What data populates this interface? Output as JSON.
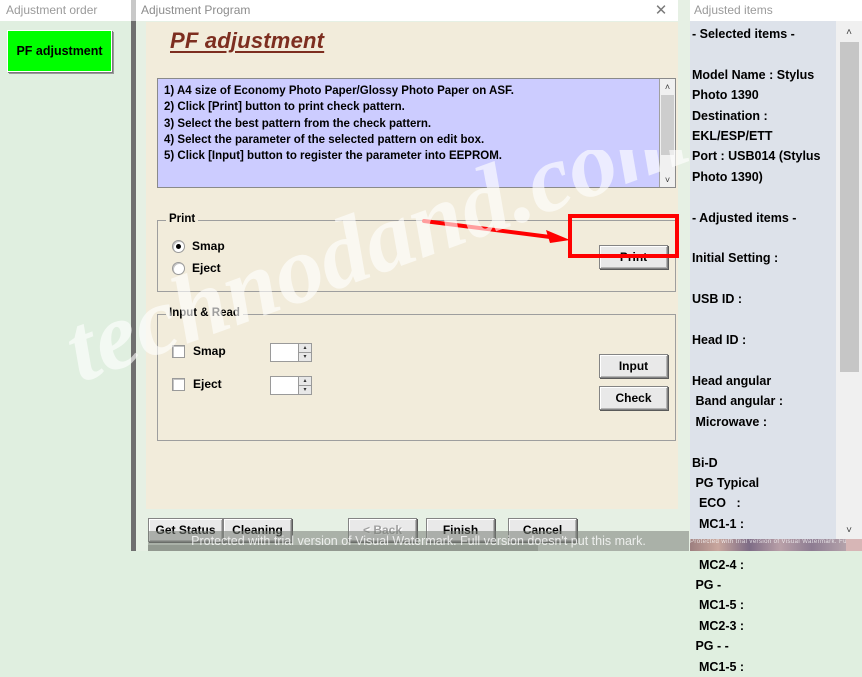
{
  "sidebar": {
    "header": "Adjustment order",
    "buttons": [
      {
        "label": "PF adjustment",
        "color": "#00ff00"
      }
    ]
  },
  "dialog": {
    "title": "Adjustment Program",
    "close_icon": "close-icon",
    "page_title": "PF adjustment",
    "instructions": "1) A4 size of Economy Photo Paper/Glossy Photo Paper on ASF.\n2) Click [Print] button to print check pattern.\n3) Select the best pattern from the check pattern.\n4) Select the parameter of the selected pattern on edit box.\n5) Click [Input] button to register the parameter into EEPROM.",
    "print_group": {
      "legend": "Print",
      "options": [
        {
          "label": "Smap",
          "selected": true
        },
        {
          "label": "Eject",
          "selected": false
        }
      ],
      "print_button": "Print"
    },
    "input_read_group": {
      "legend": "Input & Read",
      "rows": [
        {
          "label": "Smap",
          "checked": false,
          "value": ""
        },
        {
          "label": "Eject",
          "checked": false,
          "value": ""
        }
      ],
      "input_button": "Input",
      "check_button": "Check"
    },
    "footer_buttons": [
      {
        "id": "get-status",
        "label": "Get Status",
        "disabled": false
      },
      {
        "id": "cleaning",
        "label": "Cleaning",
        "disabled": false
      },
      {
        "id": "back",
        "label": "< Back",
        "disabled": true
      },
      {
        "id": "finish",
        "label": "Finish",
        "disabled": false
      },
      {
        "id": "cancel",
        "label": "Cancel",
        "disabled": false
      }
    ],
    "annotation_color": "#ff0000"
  },
  "right_panel": {
    "header": "Adjusted items",
    "body": "- Selected items -\n\nModel Name : Stylus\nPhoto 1390\nDestination :\nEKL/ESP/ETT\nPort : USB014 (Stylus\nPhoto 1390)\n\n- Adjusted items -\n\nInitial Setting :\n\nUSB ID :\n\nHead ID :\n\nHead angular\n Band angular :\n Microwave :\n\nBi-D\n PG Typical\n  ECO   :\n  MC1-1 :\n  MC1-5 :\n  MC2-4 :\n PG -\n  MC1-5 :\n  MC2-3 :\n PG - -\n  MC1-5 :"
  },
  "watermark": {
    "diagonal": "technodand.com",
    "bar": "Protected with trial version of Visual Watermark. Full version doesn't put this mark.",
    "small": "Protected with trial version of Visual Watermark. Full version doesn't put this mark."
  },
  "icons": {
    "scroll_up": "˄",
    "scroll_down": "˅",
    "spin_up": "▴",
    "spin_down": "▾",
    "close": "✕"
  }
}
